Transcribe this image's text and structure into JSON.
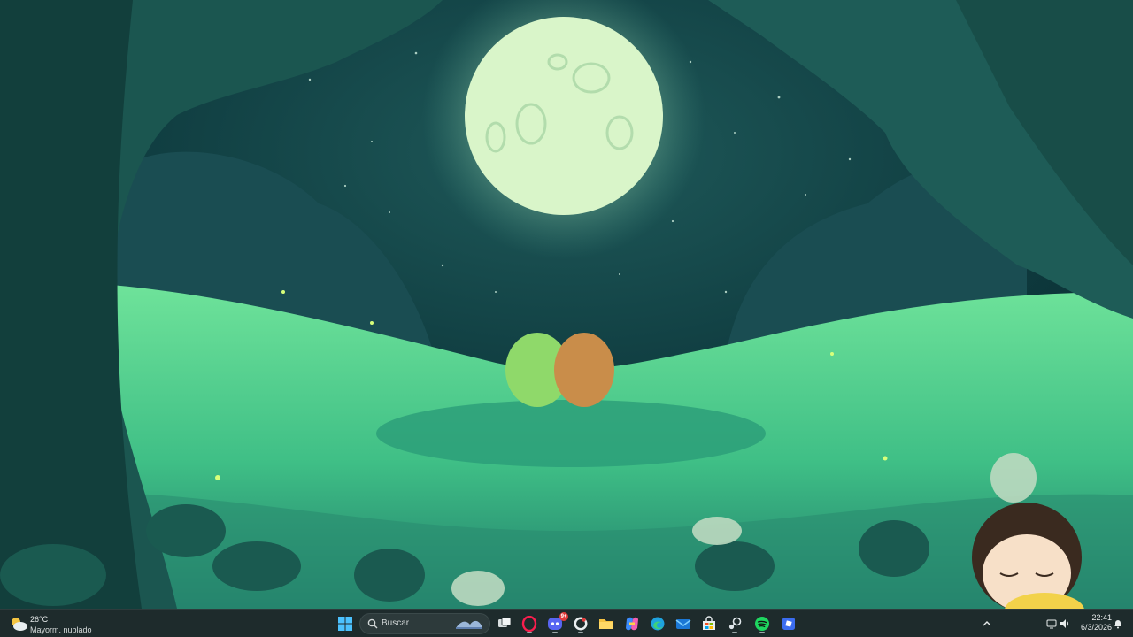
{
  "desktop": {
    "wallpaper": "forest-moon-frogs",
    "colors": {
      "sky": "#0d3b3f",
      "moon": "#d9f5c9",
      "grass": "#4fd28c",
      "shadow": "#0b2a2e"
    }
  },
  "taskbar": {
    "weather": {
      "temperature": "26°C",
      "condition": "Mayorm. nublado",
      "icon": "partly-cloudy-icon"
    },
    "search": {
      "placeholder": "Buscar"
    },
    "apps": [
      {
        "name": "start",
        "icon": "windows-logo-icon"
      },
      {
        "name": "task-view",
        "icon": "task-view-icon"
      },
      {
        "name": "opera",
        "icon": "opera-gx-icon"
      },
      {
        "name": "discord",
        "icon": "discord-icon",
        "badge": "9+"
      },
      {
        "name": "github-desktop",
        "icon": "github-icon"
      },
      {
        "name": "file-explorer",
        "icon": "folder-icon"
      },
      {
        "name": "copilot",
        "icon": "copilot-icon"
      },
      {
        "name": "edge",
        "icon": "edge-icon"
      },
      {
        "name": "mail",
        "icon": "mail-icon"
      },
      {
        "name": "store",
        "icon": "store-icon"
      },
      {
        "name": "steam",
        "icon": "steam-icon"
      },
      {
        "name": "spotify",
        "icon": "spotify-icon"
      },
      {
        "name": "roblox",
        "icon": "roblox-icon"
      }
    ],
    "tray": {
      "chevron": "chevron-up-icon"
    },
    "clock": {
      "time": "22:41",
      "date": "6/3/2026"
    }
  }
}
